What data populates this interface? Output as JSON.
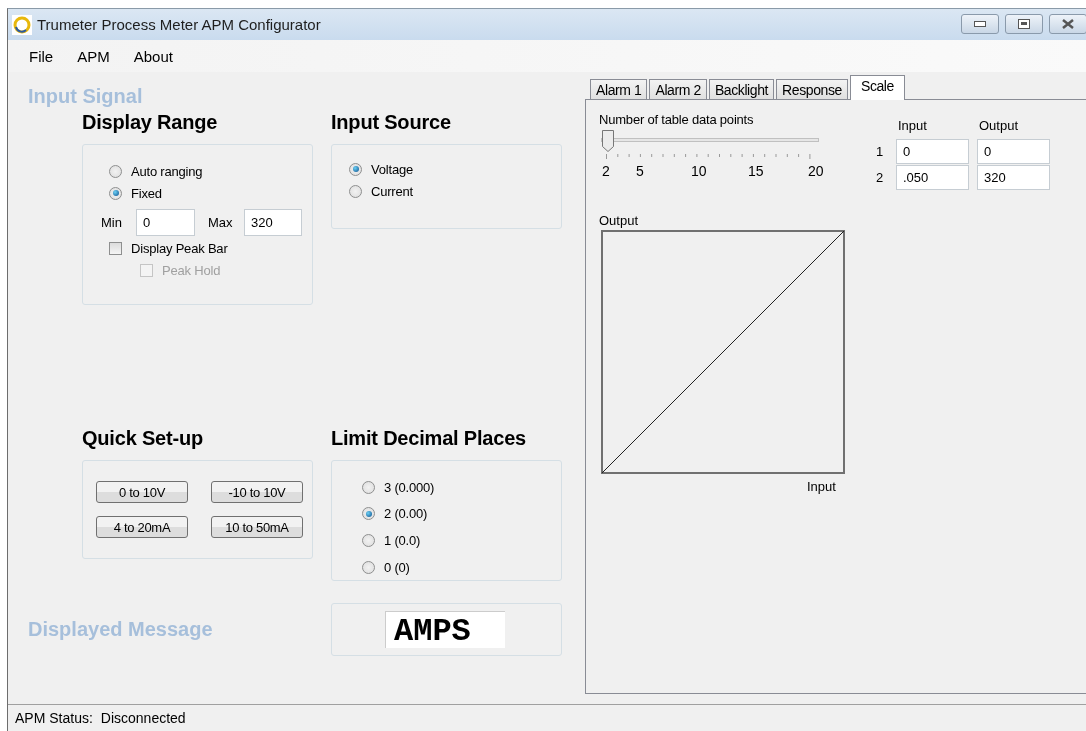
{
  "window": {
    "title": "Trumeter Process Meter APM Configurator"
  },
  "menu": [
    "File",
    "APM",
    "About"
  ],
  "input_signal": {
    "title": "Input Signal",
    "display_range": {
      "title": "Display Range",
      "options": [
        {
          "label": "Auto ranging",
          "selected": false
        },
        {
          "label": "Fixed",
          "selected": true
        }
      ],
      "min": {
        "label": "Min",
        "value": "0"
      },
      "max": {
        "label": "Max",
        "value": "320"
      },
      "checks": [
        {
          "label": "Display Peak Bar",
          "checked": false,
          "disabled": false
        },
        {
          "label": "Peak Hold",
          "checked": false,
          "disabled": true
        }
      ]
    },
    "input_source": {
      "title": "Input Source",
      "options": [
        {
          "label": "Voltage",
          "selected": true
        },
        {
          "label": "Current",
          "selected": false
        }
      ]
    },
    "quick_setup": {
      "title": "Quick Set-up",
      "buttons": [
        "0 to 10V",
        "-10 to 10V",
        "4 to 20mA",
        "10 to 50mA"
      ]
    },
    "limit_decimal_places": {
      "title": "Limit Decimal Places",
      "options": [
        {
          "label": "3 (0.000)",
          "selected": false
        },
        {
          "label": "2 (0.00)",
          "selected": true
        },
        {
          "label": "1 (0.0)",
          "selected": false
        },
        {
          "label": "0 (0)",
          "selected": false
        }
      ]
    }
  },
  "displayed_message": {
    "title": "Displayed Message",
    "value": "AMPS"
  },
  "tabs": [
    {
      "label": "Alarm 1",
      "selected": false
    },
    {
      "label": "Alarm 2",
      "selected": false
    },
    {
      "label": "Backlight",
      "selected": false
    },
    {
      "label": "Response",
      "selected": false
    },
    {
      "label": "Scale",
      "selected": true
    }
  ],
  "scale": {
    "slider_label": "Number of table data points",
    "slider": {
      "level": 0,
      "tick_labels": [
        "2",
        "5",
        "10",
        "15",
        "20"
      ]
    },
    "table": {
      "columns": [
        "Input",
        "Output"
      ],
      "rows": [
        {
          "index": "1",
          "input": "0",
          "output": "0"
        },
        {
          "index": "2",
          "input": ".050",
          "output": "320"
        }
      ]
    },
    "graph": {
      "ylabel": "Output",
      "xlabel": "Input"
    }
  },
  "status_bar": {
    "label": "APM Status:",
    "value": "Disconnected"
  }
}
